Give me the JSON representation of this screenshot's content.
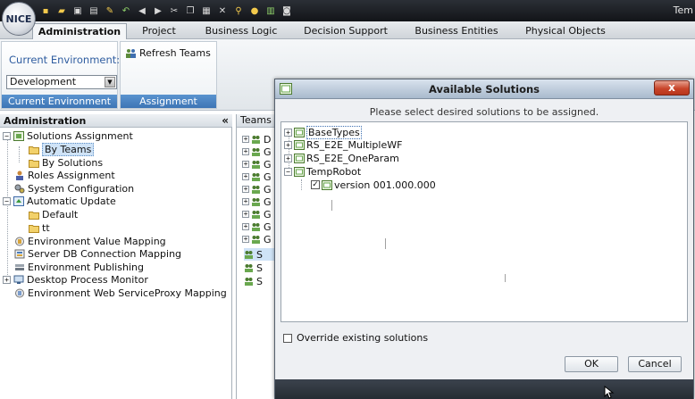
{
  "app": {
    "logo_text": "NICE",
    "title": "Tem"
  },
  "ribbon_tabs": [
    "Administration",
    "Project",
    "Business Logic",
    "Decision Support",
    "Business Entities",
    "Physical Objects"
  ],
  "ribbon": {
    "environment_group": {
      "label": "Current Environment:",
      "selected": "Development",
      "footer": "Current Environment"
    },
    "assignment_group": {
      "button": "Refresh Teams",
      "footer": "Assignment"
    }
  },
  "nav": {
    "title": "Administration",
    "collapse": "«",
    "items": [
      {
        "label": "Solutions Assignment",
        "expander": "−",
        "icon": "solutions-icon"
      },
      {
        "label": "By Teams",
        "icon": "folder-icon",
        "selected": true
      },
      {
        "label": "By Solutions",
        "icon": "folder-icon"
      },
      {
        "label": "Roles Assignment",
        "icon": "roles-icon"
      },
      {
        "label": "System Configuration",
        "icon": "gears-icon"
      },
      {
        "label": "Automatic Update",
        "expander": "−",
        "icon": "update-icon"
      },
      {
        "label": "Default",
        "icon": "folder-icon"
      },
      {
        "label": "tt",
        "icon": "folder-icon"
      },
      {
        "label": "Environment Value Mapping",
        "icon": "mapping-icon"
      },
      {
        "label": "Server DB Connection Mapping",
        "icon": "db-mapping-icon"
      },
      {
        "label": "Environment Publishing",
        "icon": "publishing-icon"
      },
      {
        "label": "Desktop Process Monitor",
        "expander": "+",
        "icon": "monitor-icon"
      },
      {
        "label": "Environment Web ServiceProxy Mapping",
        "icon": "web-mapping-icon"
      }
    ]
  },
  "teams": {
    "header": "Teams",
    "rows": [
      "D",
      "G",
      "G",
      "G",
      "G",
      "G",
      "G",
      "G",
      "G",
      "S",
      "S",
      "S"
    ]
  },
  "dialog": {
    "title": "Available Solutions",
    "close": "x",
    "subtitle": "Please select desired solutions to be assigned.",
    "solutions": [
      {
        "label": "BaseTypes",
        "expander": "+",
        "selected": true
      },
      {
        "label": "RS_E2E_MultipleWF",
        "expander": "+"
      },
      {
        "label": "RS_E2E_OneParam",
        "expander": "+"
      },
      {
        "label": "TempRobot",
        "expander": "−"
      },
      {
        "label": "version 001.000.000",
        "checked": true
      }
    ],
    "override_label": "Override existing solutions",
    "ok": "OK",
    "cancel": "Cancel"
  },
  "toolbar_icons": [
    "new-icon",
    "open-icon",
    "save-icon",
    "save-all-icon",
    "edit-icon",
    "back-icon",
    "forward-icon",
    "cut-icon",
    "copy-icon",
    "paste-icon",
    "delete-icon",
    "search-icon",
    "run-icon",
    "report-icon",
    "camera-icon"
  ],
  "colors": {
    "accent": "#3d75b5",
    "selection": "#cfe3f7",
    "close_button": "#c8452a",
    "title_bar": "#1f2328"
  }
}
